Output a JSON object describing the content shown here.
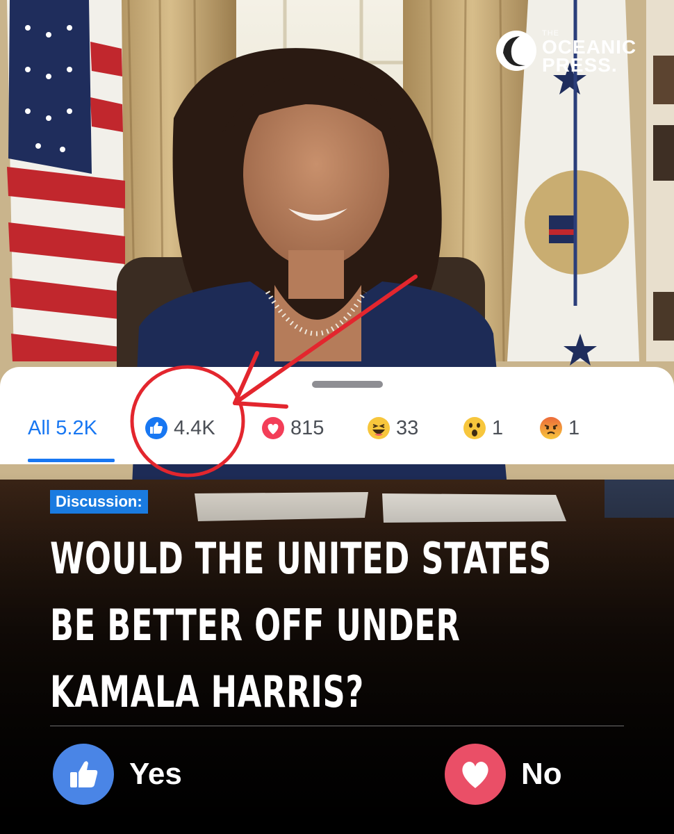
{
  "publisher": {
    "the": "THE",
    "line1": "OCEANIC",
    "line2": "PRESS."
  },
  "reactions": {
    "tabs": [
      {
        "label": "All",
        "count": "5.2K",
        "icon": "none"
      },
      {
        "count": "4.4K",
        "icon": "like-icon"
      },
      {
        "count": "815",
        "icon": "love-icon"
      },
      {
        "count": "33",
        "icon": "haha-icon"
      },
      {
        "count": "1",
        "icon": "wow-icon"
      },
      {
        "count": "1",
        "icon": "angry-icon"
      }
    ],
    "all_label": "All 5.2K"
  },
  "post": {
    "tag": "Discussion:",
    "headline_lines": [
      "WOULD THE UNITED STATES",
      "BE BETTER OFF UNDER",
      "KAMALA HARRIS?"
    ]
  },
  "poll": {
    "yes_label": "Yes",
    "no_label": "No"
  },
  "colors": {
    "facebook_blue": "#1877f2",
    "annotation_red": "#e3262e",
    "tag_blue": "#1a7be0",
    "like_circle": "#4a85e6",
    "love_circle": "#ea4f67"
  }
}
